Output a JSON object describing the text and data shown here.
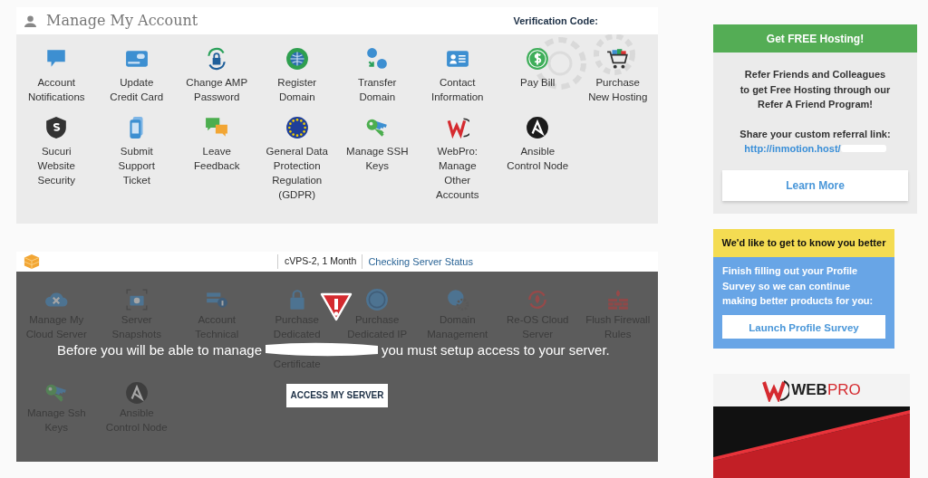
{
  "account_panel": {
    "title": "Manage My Account",
    "verification_label": "Verification Code:",
    "items": [
      {
        "lines": [
          "Account",
          "Notifications"
        ]
      },
      {
        "lines": [
          "Update",
          "Credit Card"
        ]
      },
      {
        "lines": [
          "Change AMP",
          "Password"
        ]
      },
      {
        "lines": [
          "Register",
          "Domain"
        ]
      },
      {
        "lines": [
          "Transfer",
          "Domain"
        ]
      },
      {
        "lines": [
          "Contact",
          "Information"
        ]
      },
      {
        "lines": [
          "Pay Bill"
        ]
      },
      {
        "lines": [
          "Purchase",
          "New Hosting"
        ]
      },
      {
        "lines": [
          "Sucuri",
          "Website",
          "Security"
        ]
      },
      {
        "lines": [
          "Submit",
          "Support",
          "Ticket"
        ]
      },
      {
        "lines": [
          "Leave",
          "Feedback"
        ]
      },
      {
        "lines": [
          "General Data",
          "Protection",
          "Regulation",
          "(GDPR)"
        ]
      },
      {
        "lines": [
          "Manage SSH",
          "Keys"
        ]
      },
      {
        "lines": [
          "WebPro:",
          "Manage",
          "Other",
          "Accounts"
        ]
      },
      {
        "lines": [
          "Ansible",
          "Control Node"
        ]
      }
    ]
  },
  "server_panel": {
    "plan": "cVPS-2, 1 Month",
    "status": "Checking Server Status",
    "locked": true,
    "items": [
      {
        "lines": [
          "Manage My",
          "Cloud Server"
        ]
      },
      {
        "lines": [
          "Server",
          "Snapshots"
        ]
      },
      {
        "lines": [
          "Account",
          "Technical"
        ]
      },
      {
        "lines": [
          "Purchase",
          "Dedicated"
        ],
        "lines_below_notice": [
          "Certificate"
        ]
      },
      {
        "lines": [
          "Purchase",
          "Dedicated IP"
        ]
      },
      {
        "lines": [
          "Domain",
          "Management"
        ]
      },
      {
        "lines": [
          "Re-OS Cloud",
          "Server"
        ]
      },
      {
        "lines": [
          "Flush Firewall",
          "Rules"
        ]
      },
      {
        "lines": [
          "Manage Ssh",
          "Keys"
        ]
      },
      {
        "lines": [
          "Ansible",
          "Control Node"
        ]
      }
    ],
    "notice": {
      "before": "Before you will be able to manage",
      "after": "you must setup access to your server.",
      "button": "ACCESS MY SERVER"
    }
  },
  "referral_card": {
    "header": "Get FREE Hosting!",
    "lines": [
      "Refer Friends and Colleagues",
      "to get Free Hosting through our",
      "Refer A Friend Program!"
    ],
    "share_label": "Share your custom referral link:",
    "link": "http://inmotion.host/",
    "button": "Learn More"
  },
  "survey_card": {
    "header": "We'd like to get to know you better",
    "text": "Finish filling out your Profile Survey so we can continue making better products for you:",
    "button": "Launch Profile Survey"
  },
  "webpro_card": {
    "brand_dark": "WEB",
    "brand_light": "PRO"
  }
}
